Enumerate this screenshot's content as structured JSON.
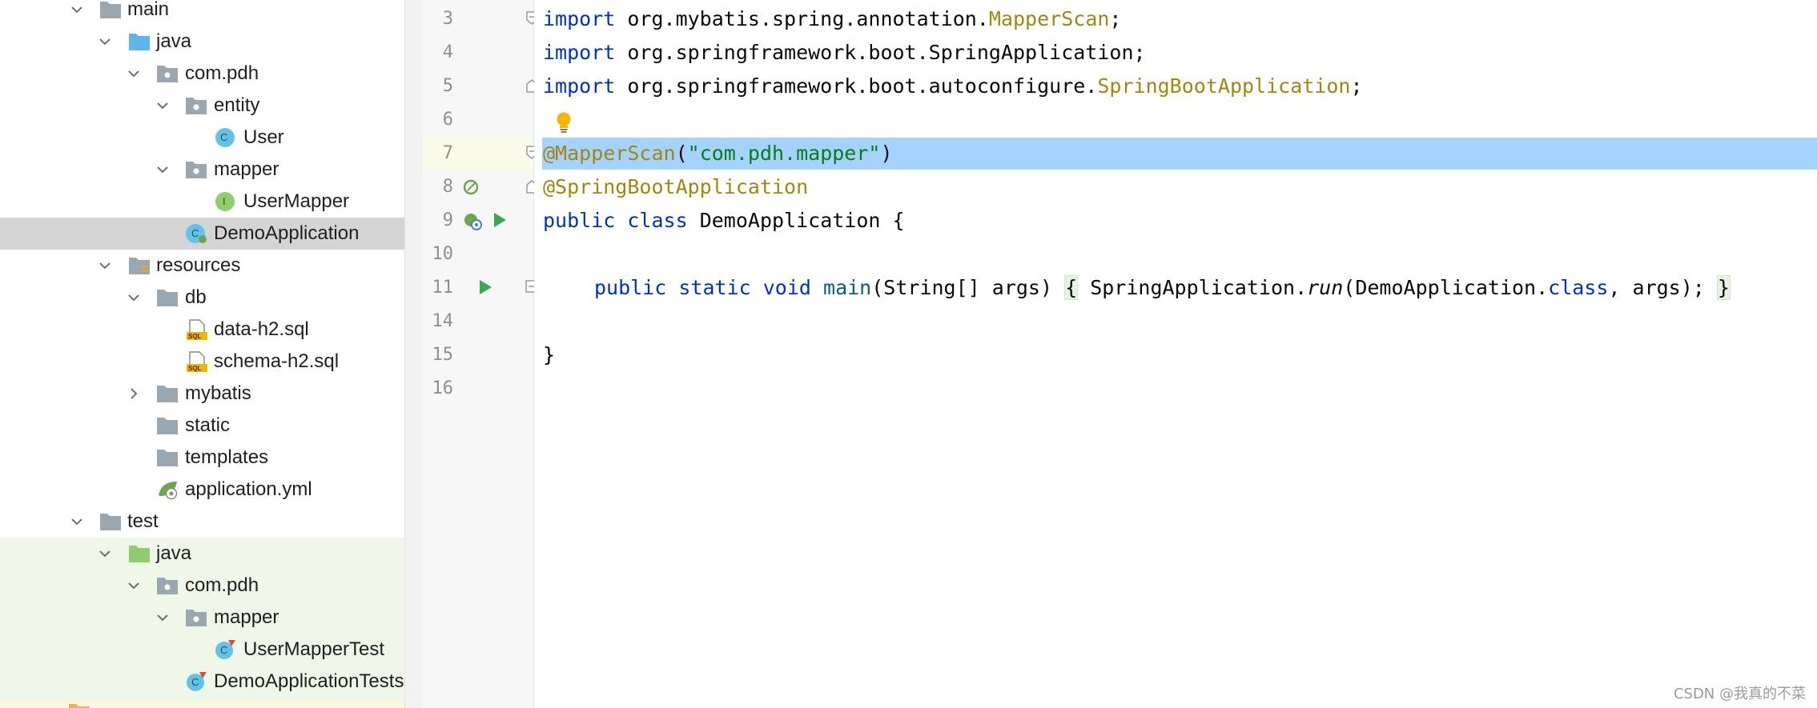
{
  "tree": {
    "items": [
      {
        "label": "main"
      },
      {
        "label": "java"
      },
      {
        "label": "com.pdh"
      },
      {
        "label": "entity"
      },
      {
        "label": "User"
      },
      {
        "label": "mapper"
      },
      {
        "label": "UserMapper"
      },
      {
        "label": "DemoApplication"
      },
      {
        "label": "resources"
      },
      {
        "label": "db"
      },
      {
        "label": "data-h2.sql"
      },
      {
        "label": "schema-h2.sql"
      },
      {
        "label": "mybatis"
      },
      {
        "label": "static"
      },
      {
        "label": "templates"
      },
      {
        "label": "application.yml"
      },
      {
        "label": "test"
      },
      {
        "label": "java"
      },
      {
        "label": "com.pdh"
      },
      {
        "label": "mapper"
      },
      {
        "label": "UserMapperTest"
      },
      {
        "label": "DemoApplicationTests"
      }
    ]
  },
  "icon_letters": {
    "class": "C",
    "interface": "I",
    "sql": "SQL"
  },
  "editor": {
    "line_numbers": [
      "3",
      "4",
      "5",
      "6",
      "7",
      "8",
      "9",
      "10",
      "11",
      "14",
      "15",
      "16"
    ],
    "line3": {
      "kw": "import",
      "pkg": " org.mybatis.spring.annotation.",
      "cls": "MapperScan",
      "end": ";"
    },
    "line4": {
      "kw": "import",
      "rest": " org.springframework.boot.SpringApplication;"
    },
    "line5": {
      "kw": "import",
      "pkg": " org.springframework.boot.autoconfigure.",
      "cls": "SpringBootApplication",
      "end": ";"
    },
    "line7": {
      "ann": "@MapperScan",
      "open": "(",
      "str": "\"com.pdh.mapper\"",
      "close": ")"
    },
    "line8": {
      "ann": "@SpringBootApplication"
    },
    "line9": {
      "kw1": "public",
      "kw2": "class",
      "rest": " DemoApplication {"
    },
    "line11": {
      "kw1": "public",
      "kw2": "static",
      "kw3": "void",
      "mth": "main",
      "params": "(String[] args) ",
      "brace_open": "{",
      "call": " SpringApplication.",
      "run": "run",
      "args_a": "(DemoApplication.",
      "kw_class": "class",
      "args_b": ", args); ",
      "brace_close": "}"
    },
    "line15": {
      "text": "}"
    }
  },
  "colors": {
    "keyword": "#0033b3",
    "annotation": "#9e880d",
    "string": "#067d17",
    "selection": "#a6d2ff"
  },
  "watermark": "CSDN @我真的不菜"
}
